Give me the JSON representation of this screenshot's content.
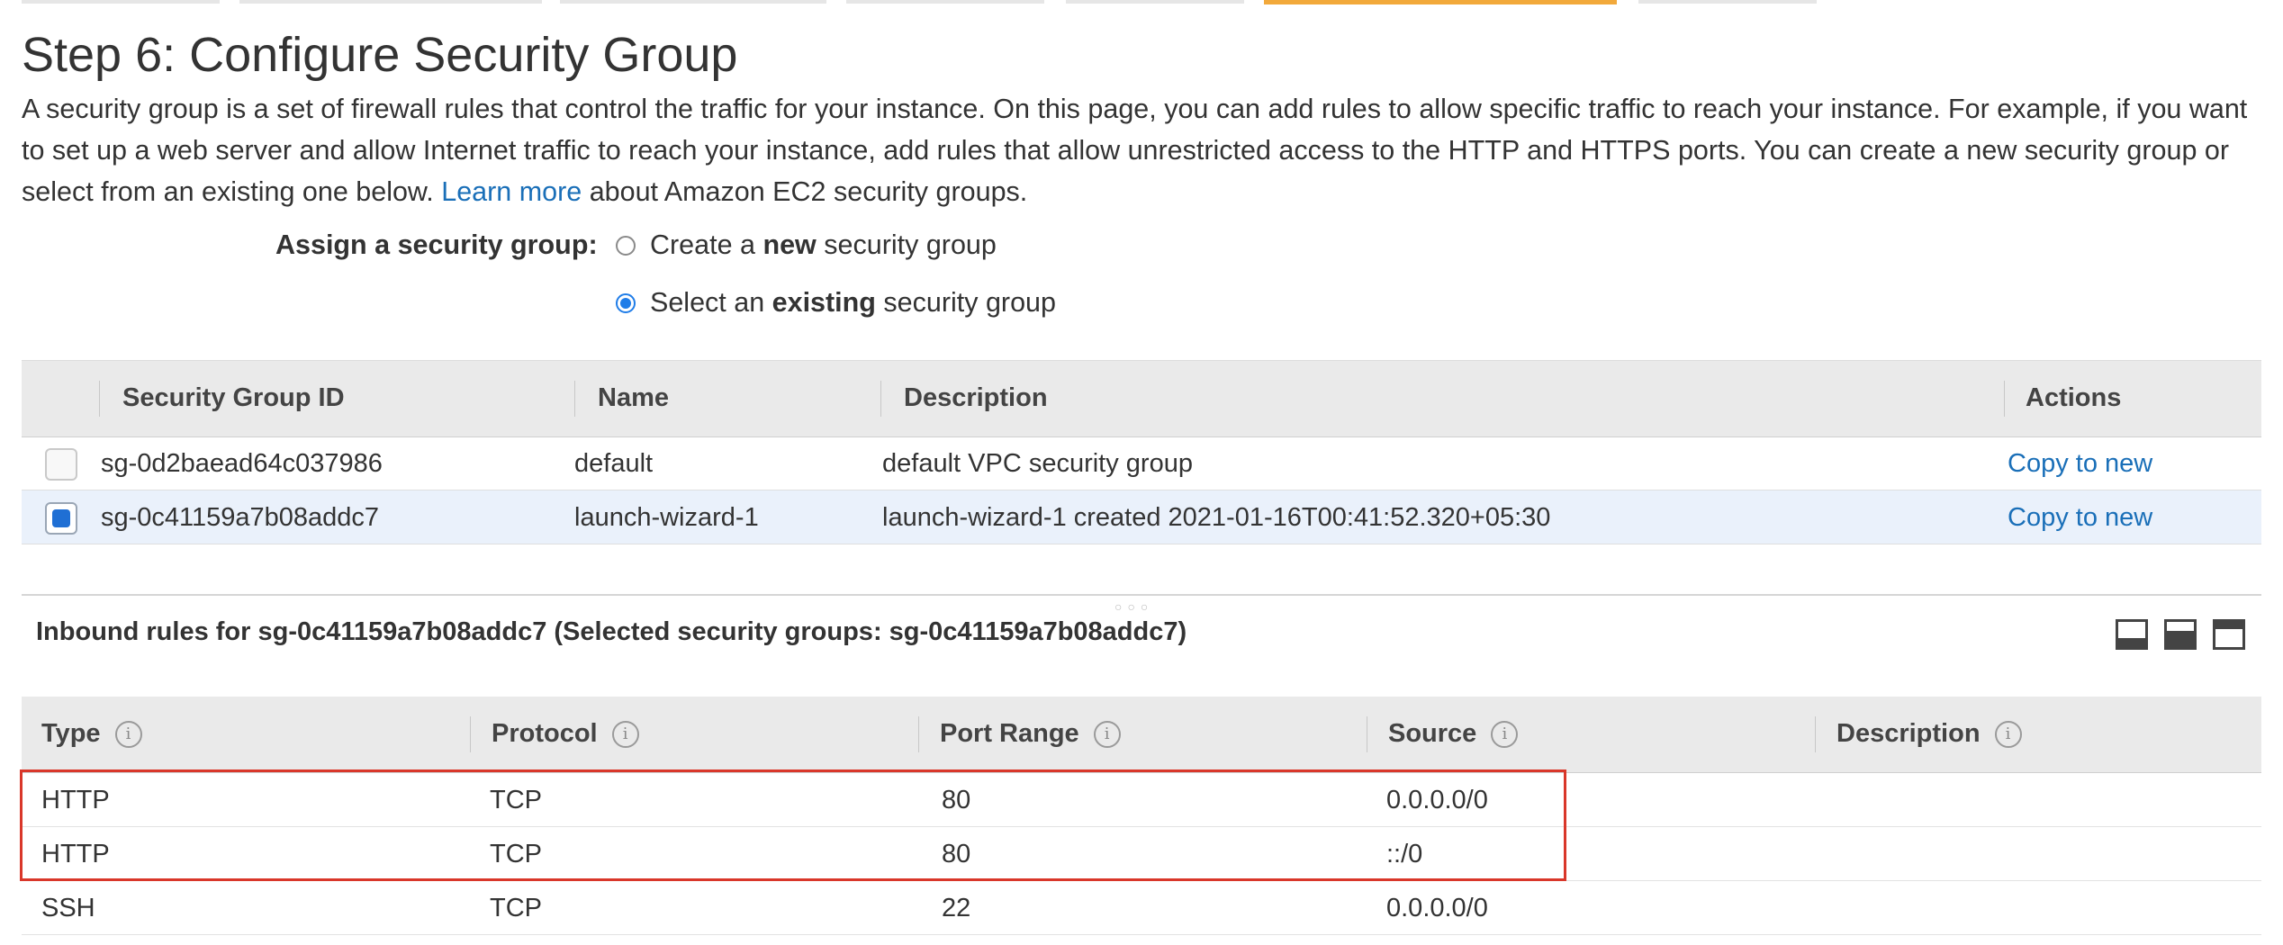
{
  "page": {
    "title": "Step 6: Configure Security Group",
    "intro_text_1": "A security group is a set of firewall rules that control the traffic for your instance. On this page, you can add rules to allow specific traffic to reach your instance. For example, if you want to set up a web server and allow Internet traffic to reach your instance, add rules that allow unrestricted access to the HTTP and HTTPS ports. You can create a new security group or select from an existing one below. ",
    "learn_more_link": "Learn more",
    "intro_text_2": " about Amazon EC2 security groups."
  },
  "assign": {
    "label": "Assign a security group:",
    "option_new": {
      "pre": "Create a ",
      "bold": "new",
      "post": " security group",
      "selected": false
    },
    "option_existing": {
      "pre": "Select an ",
      "bold": "existing",
      "post": " security group",
      "selected": true
    }
  },
  "security_groups": {
    "headers": [
      "Security Group ID",
      "Name",
      "Description",
      "Actions"
    ],
    "rows": [
      {
        "id": "sg-0d2baead64c037986",
        "name": "default",
        "description": "default VPC security group",
        "action": "Copy to new",
        "selected": false
      },
      {
        "id": "sg-0c41159a7b08addc7",
        "name": "launch-wizard-1",
        "description": "launch-wizard-1 created 2021-01-16T00:41:52.320+05:30",
        "action": "Copy to new",
        "selected": true
      }
    ]
  },
  "inbound": {
    "title": "Inbound rules for sg-0c41159a7b08addc7 (Selected security groups: sg-0c41159a7b08addc7)",
    "headers": [
      "Type",
      "Protocol",
      "Port Range",
      "Source",
      "Description"
    ],
    "info_icon_glyph": "i",
    "rows": [
      {
        "type": "HTTP",
        "protocol": "TCP",
        "port": "80",
        "source": "0.0.0.0/0",
        "description": ""
      },
      {
        "type": "HTTP",
        "protocol": "TCP",
        "port": "80",
        "source": "::/0",
        "description": ""
      },
      {
        "type": "SSH",
        "protocol": "TCP",
        "port": "22",
        "source": "0.0.0.0/0",
        "description": ""
      }
    ]
  },
  "colors": {
    "accent_tab": "#f2a93b",
    "link": "#1a6fb8",
    "selected_row": "#eaf1fb",
    "highlight_box": "#d9372a"
  }
}
